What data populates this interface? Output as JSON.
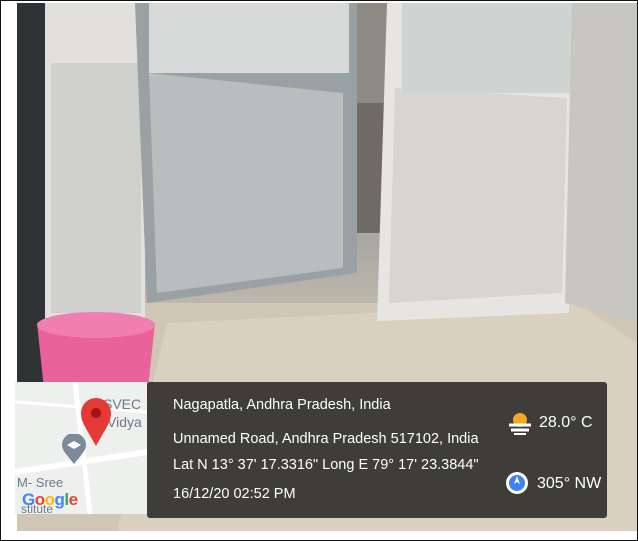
{
  "location": {
    "place": "Nagapatla, Andhra Pradesh, India",
    "address": "Unnamed Road, Andhra Pradesh 517102, India",
    "coordinates": "Lat N 13° 37' 17.3316\" Long E 79° 17' 23.3844\"",
    "datetime": "16/12/20 02:52 PM"
  },
  "weather": {
    "temperature": "28.0° C",
    "icon": "cloudy-sun-icon"
  },
  "compass": {
    "heading": "305° NW",
    "icon": "compass-icon"
  },
  "map": {
    "labels": [
      "SVEC",
      "Vidya",
      "M- Sree",
      "stitute"
    ],
    "google_logo": "Google",
    "colors": {
      "pin": "#e53935",
      "google": [
        "#4285F4",
        "#EA4335",
        "#FBBC05",
        "#4285F4",
        "#34A853",
        "#EA4335"
      ]
    }
  }
}
